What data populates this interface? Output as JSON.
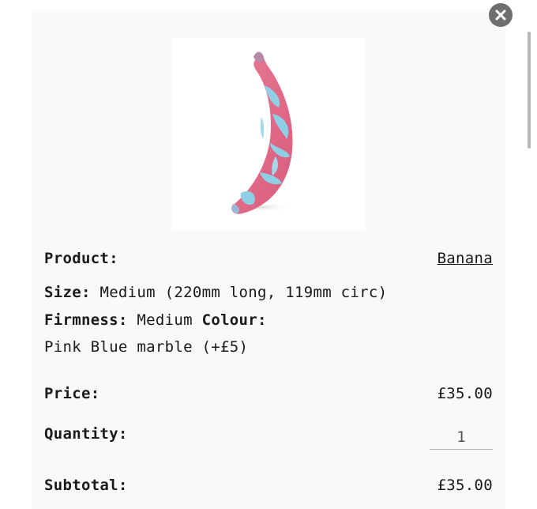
{
  "product": {
    "label": "Product:",
    "name": "Banana",
    "image_alt": "pink and blue marble banana"
  },
  "details": {
    "size_label": "Size:",
    "size_value": "Medium (220mm long, 119mm circ)",
    "firmness_label": "Firmness:",
    "firmness_value": "Medium",
    "colour_label": "Colour:",
    "colour_value": "Pink Blue marble (+£5)"
  },
  "price": {
    "label": "Price:",
    "value": "£35.00"
  },
  "quantity": {
    "label": "Quantity:",
    "value": "1"
  },
  "subtotal": {
    "label": "Subtotal:",
    "value": "£35.00"
  },
  "icons": {
    "close": "close-icon"
  },
  "colors": {
    "panel_bg": "#faf9f9",
    "close_bg": "#6e6e70",
    "banana_pink": "#e46a86",
    "banana_blue": "#8fcfe6"
  }
}
